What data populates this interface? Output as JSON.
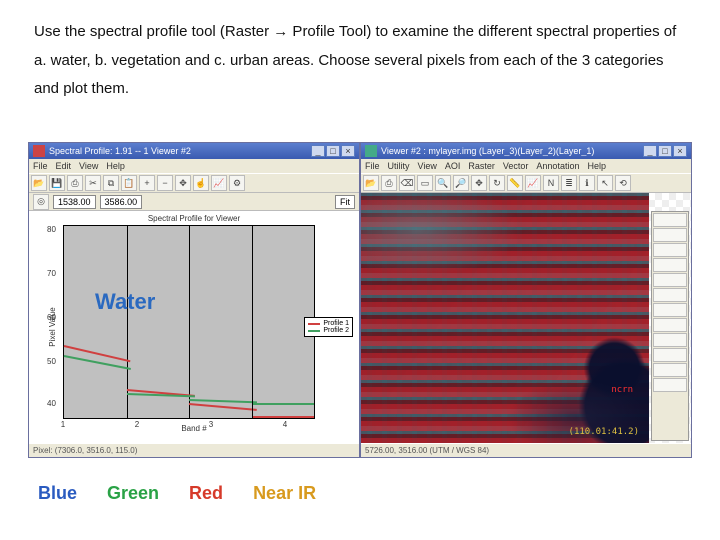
{
  "instructions": "Use the spectral profile tool (Raster → Profile Tool) to examine the different spectral properties of a. water, b. vegetation and c. urban areas. Choose several pixels from each of the 3 categories and plot them.",
  "left_window": {
    "title": "Spectral Profile: 1.91 -- 1 Viewer #2",
    "menus": [
      "File",
      "Edit",
      "View",
      "Help"
    ],
    "coords": {
      "x": "1538.00",
      "y": "3586.00",
      "mode": "Fit"
    },
    "plot": {
      "title": "Spectral Profile for Viewer",
      "ylabel": "Pixel Value",
      "xlabel": "Band #",
      "yticks": [
        "80",
        "70",
        "60",
        "50",
        "40"
      ],
      "xticks": [
        "1",
        "2",
        "3",
        "4"
      ]
    },
    "water_label": "Water",
    "legend": [
      {
        "name": "Profile 1",
        "color": "#d04040"
      },
      {
        "name": "Profile 2",
        "color": "#40a060"
      }
    ],
    "status": "Pixel: (7306.0, 3516.0, 115.0)"
  },
  "right_window": {
    "title": "Viewer #2 : mylayer.img (Layer_3)(Layer_2)(Layer_1)",
    "menus": [
      "File",
      "Utility",
      "View",
      "AOI",
      "Raster",
      "Vector",
      "Annotation",
      "Help"
    ],
    "status": "5726.00, 3516.00 (UTM / WGS 84)",
    "overlay_coord": "(110.01:41.2)",
    "overlay_mark": "ncrn"
  },
  "bands": [
    {
      "label": "Blue",
      "color": "#2a5bc0"
    },
    {
      "label": "Green",
      "color": "#2aa246"
    },
    {
      "label": "Red",
      "color": "#d63a2a"
    },
    {
      "label": "Near IR",
      "color": "#d89a1e"
    }
  ],
  "chart_data": {
    "type": "line",
    "title": "Spectral Profile for Viewer",
    "xlabel": "Band #",
    "ylabel": "Pixel Value",
    "x": [
      1,
      2,
      3,
      4
    ],
    "ylim": [
      40,
      80
    ],
    "series": [
      {
        "name": "Profile 1",
        "color": "#d04040",
        "values": [
          55,
          46,
          43,
          40
        ]
      },
      {
        "name": "Profile 2",
        "color": "#40a060",
        "values": [
          53,
          45,
          44,
          43
        ]
      }
    ]
  }
}
